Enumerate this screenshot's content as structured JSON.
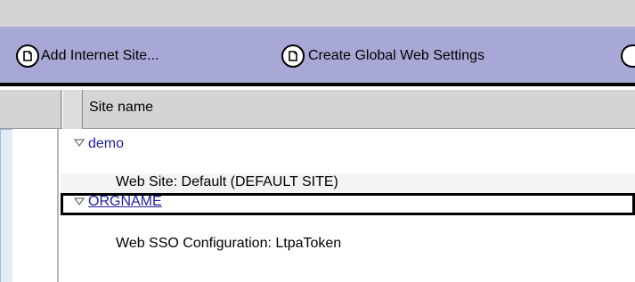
{
  "toolbar": {
    "add_internet_site_label": "Add Internet Site...",
    "create_global_web_settings_label": "Create Global Web Settings",
    "button_icon": "circle-document-icon"
  },
  "table": {
    "column_header": "Site name",
    "rows": [
      {
        "type": "group",
        "label": "demo",
        "expanded": true
      },
      {
        "type": "item",
        "label": "Web Site: Default (DEFAULT SITE)"
      },
      {
        "type": "group",
        "label": "ORGNAME",
        "expanded": true,
        "selected": true
      },
      {
        "type": "item",
        "label": "Web SSO Configuration: LtpaToken"
      }
    ]
  },
  "colors": {
    "toolbar_bg": "#a8a8d6",
    "header_bg": "#d4d4d4",
    "group_text": "#1f1f9a",
    "left_panel_bg": "#e3ecf5"
  }
}
